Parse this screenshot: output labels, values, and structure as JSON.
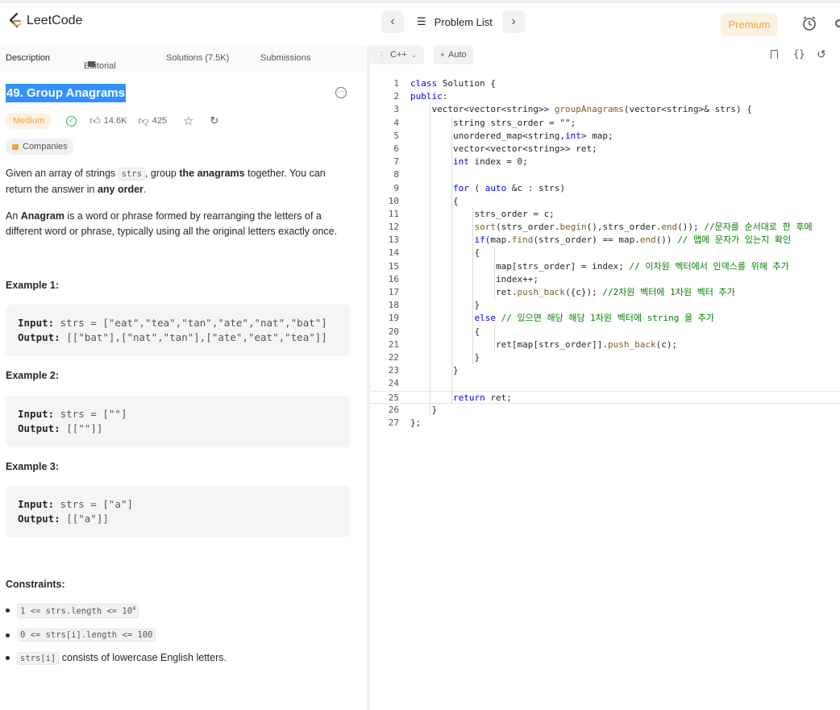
{
  "topbar": {
    "logo_text": "LeetCode",
    "problem_list_label": "Problem List",
    "premium_label": "Premium",
    "prev_icon": "chevron-left-icon",
    "next_icon": "chevron-right-icon",
    "timer_icon": "alarm-clock-icon"
  },
  "left_tabs": {
    "description": "Description",
    "editorial": "Editorial",
    "solutions": "Solutions (7.5K)",
    "submissions": "Submissions"
  },
  "problem": {
    "title": "49. Group Anagrams",
    "difficulty": "Medium",
    "likes": "14.6K",
    "dislikes": "425",
    "companies_label": "Companies",
    "desc1_a": "Given an array of strings ",
    "desc1_code": "strs",
    "desc1_b": ", group ",
    "desc1_bold": "the anagrams",
    "desc1_c": " together. You can",
    "desc1_d": "return the answer in ",
    "desc1_bold2": "any order",
    "desc1_e": ".",
    "desc2_a": "An ",
    "desc2_bold": "Anagram",
    "desc2_b": " is a word or phrase formed by rearranging the letters of a",
    "desc2_c": "different word or phrase, typically using all the original letters exactly once."
  },
  "examples": [
    {
      "heading": "Example 1:",
      "input_label": "Input:",
      "input": " strs = [\"eat\",\"tea\",\"tan\",\"ate\",\"nat\",\"bat\"]",
      "output_label": "Output:",
      "output": " [[\"bat\"],[\"nat\",\"tan\"],[\"ate\",\"eat\",\"tea\"]]"
    },
    {
      "heading": "Example 2:",
      "input_label": "Input:",
      "input": " strs = [\"\"]",
      "output_label": "Output:",
      "output": " [[\"\"]]"
    },
    {
      "heading": "Example 3:",
      "input_label": "Input:",
      "input": " strs = [\"a\"]",
      "output_label": "Output:",
      "output": " [[\"a\"]]"
    }
  ],
  "constraints": {
    "heading": "Constraints:",
    "c1": "1 <= strs.length <= 10",
    "c1_sup": "4",
    "c2": "0 <= strs[i].length <= 100",
    "c3_code": "strs[i]",
    "c3_text": " consists of lowercase English letters."
  },
  "editor": {
    "language": "C++",
    "mode": "Auto"
  },
  "code_lines": [
    "class Solution {",
    "public:",
    "    vector<vector<string>> groupAnagrams(vector<string>& strs) {",
    "        string strs_order = \"\";",
    "        unordered_map<string,int> map;",
    "        vector<vector<string>> ret;",
    "        int index = 0;",
    "",
    "        for ( auto &c : strs)",
    "        {",
    "            strs_order = c;",
    "            sort(strs_order.begin(),strs_order.end()); //문자를 순서대로 한 후에",
    "            if(map.find(strs_order) == map.end()) // 맵에 문자가 있는지 확인",
    "            {",
    "                map[strs_order] = index; // 이차원 벡터에서 인덱스를 위해 추가",
    "                index++;",
    "                ret.push_back({c}); //2차원 벡터에 1차원 벡터 추가",
    "            }",
    "            else // 있으면 해당 해당 1차원 벡터에 string 을 추가",
    "            {",
    "                ret[map[strs_order]].push_back(c);",
    "            }",
    "        }",
    "",
    "        return ret;",
    "    }",
    "};"
  ]
}
